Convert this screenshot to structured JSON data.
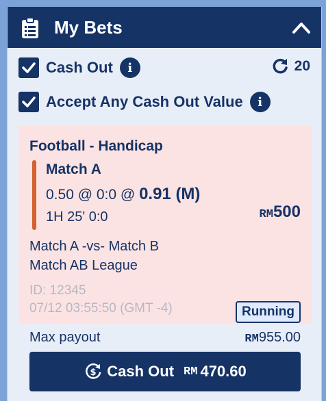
{
  "header": {
    "title": "My Bets",
    "icon": "clipboard-icon",
    "collapse_icon": "chevron-up-icon"
  },
  "options": {
    "cash_out_label": "Cash Out",
    "accept_any_label": "Accept Any Cash Out Value",
    "info_icon_glyph": "i",
    "refresh_count": "20"
  },
  "bet": {
    "type": "Football - Handicap",
    "match": "Match A",
    "odds_prefix": "0.50 @ 0:0 @",
    "odds_value": "0.91 (M)",
    "time": "1H 25' 0:0",
    "stake_currency": "RM",
    "stake_amount": "500",
    "teams": "Match A -vs- Match B",
    "league": "Match AB League",
    "id": "ID: 12345",
    "datetime": "07/12 03:55:50 (GMT -4)",
    "status": "Running"
  },
  "payout": {
    "label": "Max payout",
    "currency": "RM",
    "value": "955.00"
  },
  "cashout_button": {
    "label": "Cash Out",
    "currency": "RM",
    "amount": "470.60"
  },
  "colors": {
    "primary": "#163366",
    "bet_card_bg": "#fbe3e3",
    "accent": "#d2622e",
    "page_bg": "#7da2d8"
  }
}
